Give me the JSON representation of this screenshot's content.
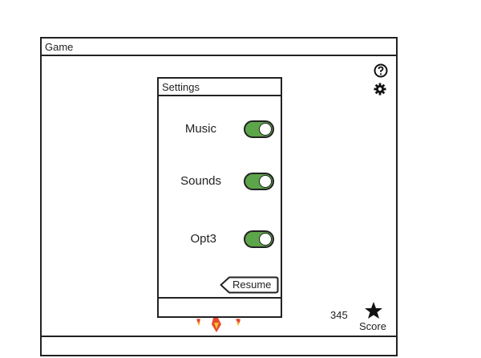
{
  "window": {
    "title": "Game"
  },
  "icons": {
    "help": "help-icon",
    "settings": "gear-icon",
    "star": "star-icon"
  },
  "settings": {
    "title": "Settings",
    "options": [
      {
        "label": "Music",
        "on": true
      },
      {
        "label": "Sounds",
        "on": true
      },
      {
        "label": "Opt3",
        "on": true
      }
    ],
    "resume_label": "Resume"
  },
  "score": {
    "value": "345",
    "label": "Score"
  },
  "colors": {
    "toggle_on": "#5da54a",
    "star": "#f4c542",
    "shield": "#2a78c4"
  }
}
